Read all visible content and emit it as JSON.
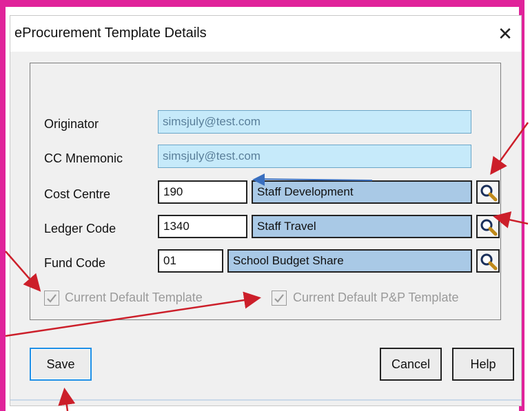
{
  "window": {
    "title": "eProcurement Template Details",
    "close_glyph": "✕"
  },
  "form": {
    "originator": {
      "label": "Originator",
      "value": "simsjuly@test.com"
    },
    "cc_mnemonic": {
      "label": "CC Mnemonic",
      "value": "simsjuly@test.com"
    },
    "cost_centre": {
      "label": "Cost Centre",
      "code": "190",
      "description": "Staff Development"
    },
    "ledger_code": {
      "label": "Ledger Code",
      "code": "1340",
      "description": "Staff Travel"
    },
    "fund_code": {
      "label": "Fund Code",
      "code": "01",
      "description": "School Budget Share"
    }
  },
  "checkboxes": {
    "default_template": {
      "label": "Current Default Template",
      "checked": true
    },
    "default_pp_template": {
      "label": "Current Default P&P Template",
      "checked": true
    }
  },
  "buttons": {
    "save": "Save",
    "cancel": "Cancel",
    "help": "Help"
  },
  "icons": {
    "lookup": "magnifier-icon",
    "close": "close-icon",
    "check": "checkmark-icon"
  },
  "colors": {
    "frame": "#e0239a",
    "annotation_arrow": "#cc1f2a",
    "readonly_field": "#c6eafa",
    "description_field": "#a9c9e6"
  }
}
